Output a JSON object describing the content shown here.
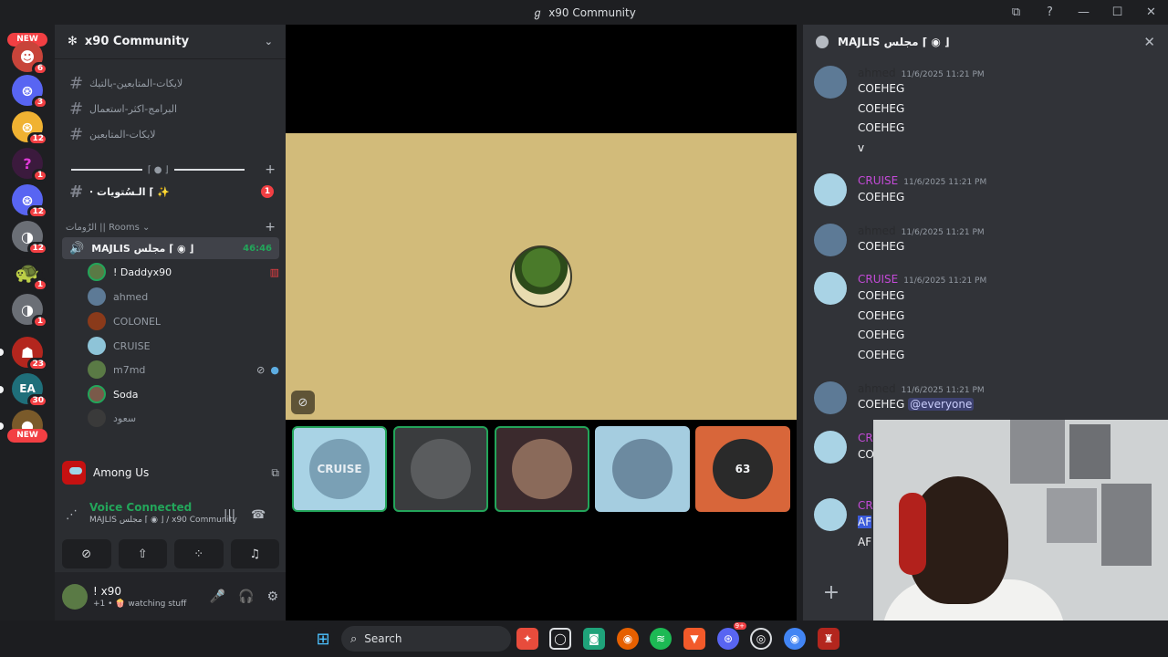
{
  "window": {
    "title": "x90 Community",
    "controls": [
      "⧉",
      "?",
      "—",
      "☐",
      "✕"
    ]
  },
  "rail": {
    "servers": [
      {
        "badge": "6"
      },
      {
        "badge": "3"
      },
      {
        "badge": "12"
      },
      {
        "badge": "1"
      },
      {
        "badge": "12"
      },
      {
        "badge": "12"
      },
      {
        "badge": "1"
      },
      {
        "badge": "1"
      },
      {
        "badge": "23"
      },
      {
        "badge": "30"
      }
    ],
    "new_labels": [
      "NEW",
      "NEW"
    ]
  },
  "sidebar": {
    "server_name": "x90 Community",
    "channels": [
      {
        "name": "لايكات-المتابعين-بالتيك"
      },
      {
        "name": "البرامج-اكثر-استعمال"
      },
      {
        "name": "لايكات-المتابعين"
      }
    ],
    "special_channel": {
      "name": "⋅ الـسُتويات ⌈ ✨",
      "badge": "1"
    },
    "category": "الرُومات || Rooms ⌄",
    "voice_channel": {
      "name": "MAJLIS مجلس ⌈ ◉ ⌋",
      "timer": "46:46"
    },
    "members": [
      {
        "name": "! Daddyx90"
      },
      {
        "name": "ahmed"
      },
      {
        "name": "COLONEL"
      },
      {
        "name": "CRUISE"
      },
      {
        "name": "m7md"
      },
      {
        "name": "Soda"
      },
      {
        "name": "سعود"
      }
    ],
    "activity": {
      "name": "Among Us"
    },
    "voice_connected": {
      "title": "Voice Connected",
      "subtitle": "MAJLIS مجلس ⌈ ◉ ⌋ / x90 Community"
    },
    "user": {
      "name": "! x90",
      "status": "+1 • 🍿 watching stuff"
    }
  },
  "main": {
    "tiles": [
      {
        "label": "CRUISE"
      },
      {
        "label": ""
      },
      {
        "label": ""
      },
      {
        "label": ""
      },
      {
        "label": "63"
      }
    ]
  },
  "chat": {
    "title": "MAJLIS مجلس ⌈ ◉ ⌋",
    "messages": [
      {
        "author": "ahmed",
        "time": "11/6/2025 11:21 PM",
        "lines": [
          "COEHEG",
          "COEHEG",
          "COEHEG",
          "v"
        ]
      },
      {
        "author": "CRUISE",
        "time": "11/6/2025 11:21 PM",
        "lines": [
          "COEHEG"
        ]
      },
      {
        "author": "ahmed",
        "time": "11/6/2025 11:21 PM",
        "lines": [
          "COEHEG"
        ]
      },
      {
        "author": "CRUISE",
        "time": "11/6/2025 11:21 PM",
        "lines": [
          "COEHEG",
          "COEHEG",
          "COEHEG",
          "COEHEG"
        ]
      },
      {
        "author": "ahmed",
        "time": "11/6/2025 11:21 PM",
        "lines": [
          "COEHEG"
        ],
        "mention": "@everyone"
      },
      {
        "author": "CR",
        "time": "",
        "lines": [
          "CO"
        ]
      },
      {
        "author": "CR",
        "time": "",
        "lines": [
          "AF",
          "AF"
        ]
      }
    ]
  },
  "taskbar": {
    "search_placeholder": "Search",
    "discord_badge": "9+"
  }
}
